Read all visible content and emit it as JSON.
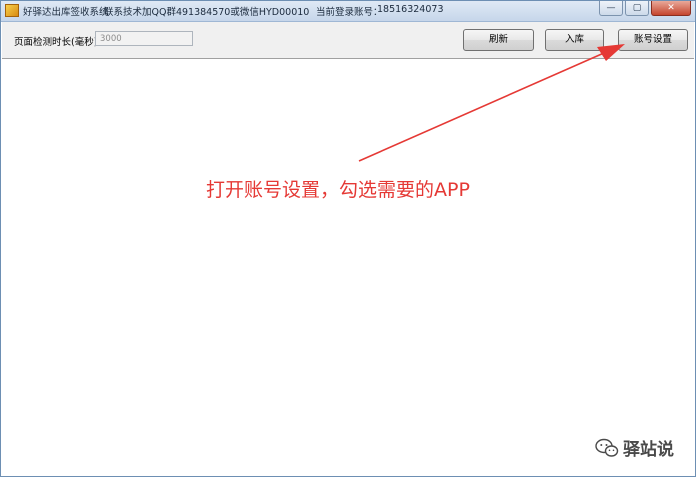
{
  "titlebar": {
    "app_name": "好驿达出库签收系统",
    "contact": "联系技术加QQ群491384570或微信HYD00010",
    "account_label": "当前登录账号：",
    "account_number": "18516324073",
    "controls": {
      "minimize": "—",
      "maximize": "▢",
      "close": "✕"
    }
  },
  "toolbar": {
    "interval_label": "页面检测时长(毫秒)",
    "interval_value": "3000",
    "refresh_label": "刷新",
    "stock_in_label": "入库",
    "account_settings_label": "账号设置"
  },
  "annotation": {
    "text": "打开账号设置，勾选需要的APP",
    "color": "#e53935"
  },
  "watermark": {
    "icon": "wechat-icon",
    "text": "驿站说"
  }
}
